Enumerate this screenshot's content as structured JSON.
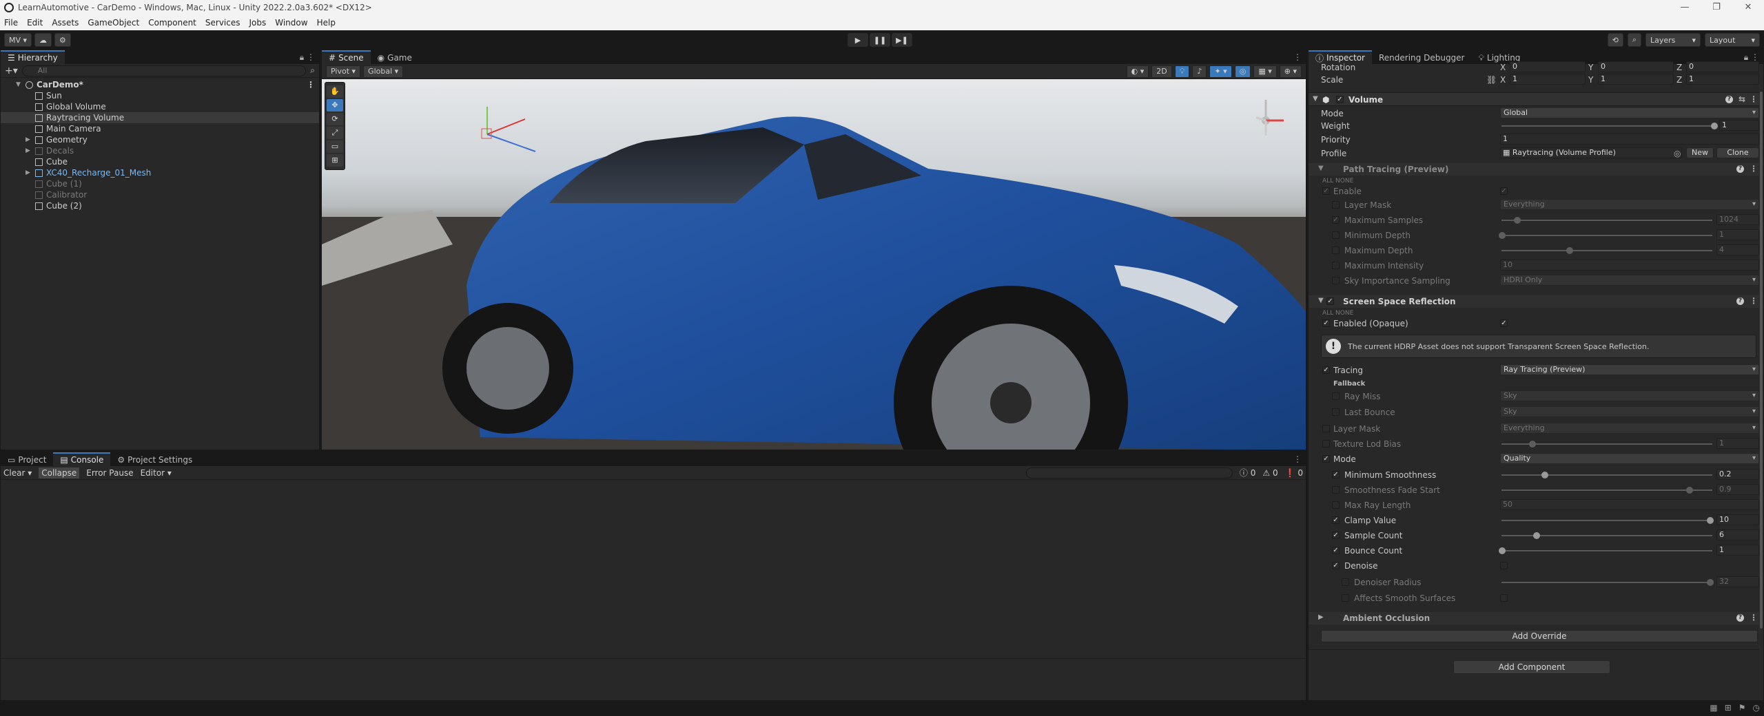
{
  "window": {
    "title": "LearnAutomotive - CarDemo - Windows, Mac, Linux - Unity 2022.2.0a3.602* <DX12>",
    "minimize": "—",
    "maximize": "❐",
    "close": "✕"
  },
  "menu": [
    "File",
    "Edit",
    "Assets",
    "GameObject",
    "Component",
    "Services",
    "Jobs",
    "Window",
    "Help"
  ],
  "toolbar": {
    "account": "MV ▾",
    "layers": "Layers",
    "layout": "Layout",
    "play": "▶",
    "pause": "❚❚",
    "step": "▶❚"
  },
  "hierarchy": {
    "tab": "Hierarchy",
    "search_placeholder": "All",
    "items": [
      {
        "label": "CarDemo*",
        "depth": 0,
        "root": true
      },
      {
        "label": "Sun",
        "depth": 1
      },
      {
        "label": "Global Volume",
        "depth": 1
      },
      {
        "label": "Raytracing Volume",
        "depth": 1,
        "selected": true
      },
      {
        "label": "Main Camera",
        "depth": 1
      },
      {
        "label": "Geometry",
        "depth": 1,
        "arrow": true
      },
      {
        "label": "Decals",
        "depth": 1,
        "arrow": true,
        "disabled": true
      },
      {
        "label": "Cube",
        "depth": 1
      },
      {
        "label": "XC40_Recharge_01_Mesh",
        "depth": 1,
        "arrow": true,
        "prefab": true
      },
      {
        "label": "Cube (1)",
        "depth": 1,
        "disabled": true
      },
      {
        "label": "Calibrator",
        "depth": 1,
        "disabled": true
      },
      {
        "label": "Cube (2)",
        "depth": 1
      }
    ]
  },
  "scene": {
    "tabs": [
      "Scene",
      "Game"
    ],
    "pivot": "Pivot",
    "global": "Global",
    "mode_2d": "2D"
  },
  "console": {
    "tabs": [
      "Project",
      "Console",
      "Project Settings"
    ],
    "clear": "Clear",
    "collapse": "Collapse",
    "error_pause": "Error Pause",
    "editor": "Editor",
    "count_info": "0",
    "count_warn": "0",
    "count_error": "0"
  },
  "inspector": {
    "tabs": [
      "Inspector",
      "Rendering Debugger",
      "Lighting"
    ],
    "rotation_label": "Rotation",
    "rotation": {
      "x": "0",
      "y": "0",
      "z": "0"
    },
    "scale_label": "Scale",
    "scale": {
      "x": "1",
      "y": "1",
      "z": "1"
    },
    "volume": {
      "header": "Volume",
      "mode_label": "Mode",
      "mode": "Global",
      "weight_label": "Weight",
      "weight": "1",
      "priority_label": "Priority",
      "priority": "1",
      "profile_label": "Profile",
      "profile": "Raytracing (Volume Profile)",
      "new": "New",
      "clone": "Clone"
    },
    "path_tracing": {
      "header": "Path Tracing (Preview)",
      "all_none": "ALL  NONE",
      "enable": "Enable",
      "layer_mask": "Layer Mask",
      "layer_mask_val": "Everything",
      "max_samples": "Maximum Samples",
      "max_samples_val": "1024",
      "min_depth": "Minimum Depth",
      "min_depth_val": "1",
      "max_depth": "Maximum Depth",
      "max_depth_val": "4",
      "max_intensity": "Maximum Intensity",
      "max_intensity_val": "10",
      "sky_importance": "Sky Importance Sampling",
      "sky_importance_val": "HDRI Only"
    },
    "ssr": {
      "header": "Screen Space Reflection",
      "all_none": "ALL  NONE",
      "enabled_opaque": "Enabled (Opaque)",
      "warning": "The current HDRP Asset does not support Transparent Screen Space Reflection.",
      "tracing": "Tracing",
      "tracing_val": "Ray Tracing (Preview)",
      "fallback": "Fallback",
      "ray_miss": "Ray Miss",
      "ray_miss_val": "Sky",
      "last_bounce": "Last Bounce",
      "last_bounce_val": "Sky",
      "layer_mask": "Layer Mask",
      "layer_mask_val": "Everything",
      "texture_lod": "Texture Lod Bias",
      "texture_lod_val": "1",
      "mode": "Mode",
      "mode_val": "Quality",
      "min_smooth": "Minimum Smoothness",
      "min_smooth_val": "0.2",
      "smooth_fade": "Smoothness Fade Start",
      "smooth_fade_val": "0.9",
      "max_ray": "Max Ray Length",
      "max_ray_val": "50",
      "clamp": "Clamp Value",
      "clamp_val": "10",
      "sample_count": "Sample Count",
      "sample_count_val": "6",
      "bounce_count": "Bounce Count",
      "bounce_count_val": "1",
      "denoise": "Denoise",
      "denoiser_radius": "Denoiser Radius",
      "denoiser_radius_val": "32",
      "affects_smooth": "Affects Smooth Surfaces"
    },
    "ambient_occlusion": "Ambient Occlusion",
    "add_override": "Add Override",
    "add_component": "Add Component"
  }
}
